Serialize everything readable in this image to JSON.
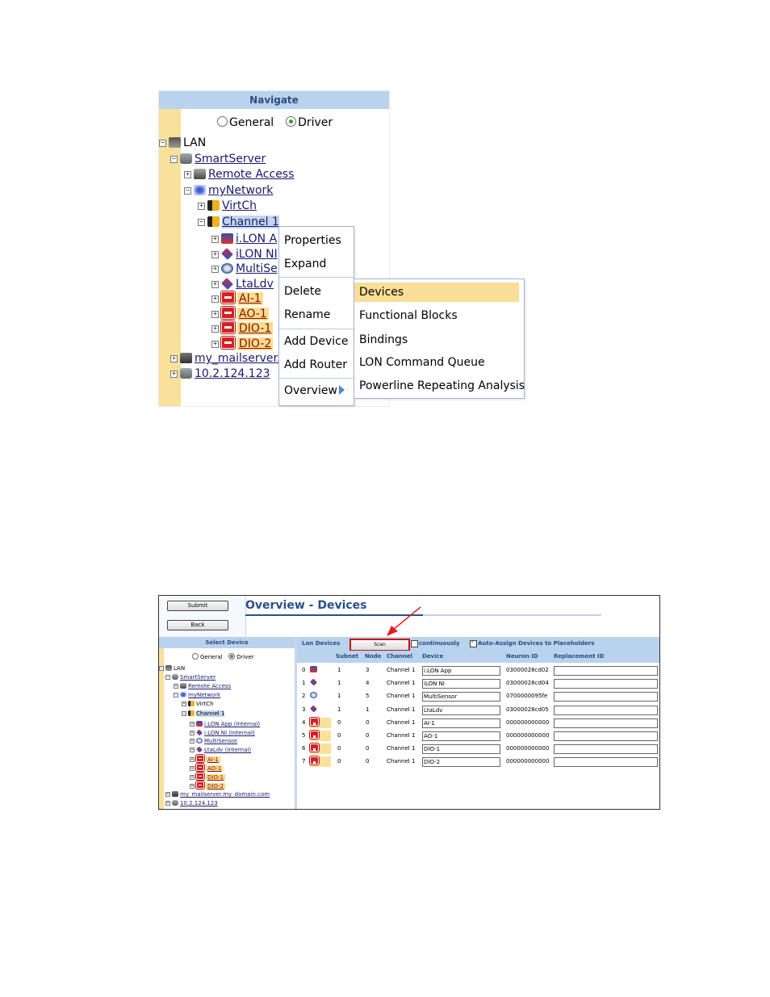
{
  "navigate": {
    "title": "Navigate",
    "view_options": [
      {
        "label": "General",
        "selected": false
      },
      {
        "label": "Driver",
        "selected": true
      }
    ],
    "tree": {
      "lan": "LAN",
      "smartserver": "SmartServer",
      "remote_access": "Remote Access",
      "mynetwork": "myNetwork",
      "virtch": "VirtCh",
      "channel1": "Channel 1",
      "ilon_app": "i.LON A",
      "ilon_ni": "iLON NI",
      "multisensor": "MultiSe",
      "ltaldv": "LtaLdv",
      "ai1": "AI-1",
      "ao1": "AO-1",
      "dio1": "DIO-1",
      "dio2": "DIO-2",
      "mailserver": "my_mailserver.",
      "ip": "10.2.124.123"
    }
  },
  "context_menu": {
    "items": [
      "Properties",
      "Expand",
      "Delete",
      "Rename",
      "Add Device",
      "Add Router",
      "Overview"
    ],
    "submenu": [
      "Devices",
      "Functional Blocks",
      "Bindings",
      "LON Command Queue",
      "Powerline Repeating Analysis"
    ],
    "active_submenu": "Devices"
  },
  "overview": {
    "title": "Overview - Devices",
    "submit_label": "Submit",
    "back_label": "Back",
    "select_device": {
      "title": "Select Device",
      "view_options": [
        {
          "label": "General",
          "selected": false
        },
        {
          "label": "Driver",
          "selected": true
        }
      ],
      "tree": {
        "lan": "LAN",
        "smartserver": "SmartServer",
        "remote_access": "Remote Access",
        "mynetwork": "myNetwork",
        "virtch": "VirtCh",
        "channel1": "Channel 1",
        "ilon_app": "i.LON App (Internal)",
        "ilon_ni": "i.LON NI (Internal)",
        "multisensor": "MultiSensor",
        "ltaldv": "LtaLdv (Internal)",
        "ai1": "AI-1",
        "ao1": "AO-1",
        "dio1": "DIO-1",
        "dio2": "DIO-2",
        "mailserver": "my_mailserver.my_domain.com",
        "ip": "10.2.124.123"
      }
    },
    "lon_devices": {
      "title": "Lon Devices",
      "scan_label": "Scan",
      "continuously_label": "continuously",
      "continuously_checked": false,
      "auto_assign_label": "Auto-Assign Devices to Placeholders",
      "auto_assign_checked": true,
      "columns": [
        "Subnet",
        "Node",
        "Channel",
        "Device",
        "Neuron ID",
        "Replacement ID"
      ],
      "rows": [
        {
          "index": "0",
          "icon": "ilon-app-icon",
          "subnet": "1",
          "node": "3",
          "channel": "Channel 1",
          "device": "i.LON App",
          "neuron_id": "03000028cd02",
          "replacement_id": ""
        },
        {
          "index": "1",
          "icon": "ilon-ni-icon",
          "subnet": "1",
          "node": "4",
          "channel": "Channel 1",
          "device": "iLON NI",
          "neuron_id": "03000028cd04",
          "replacement_id": ""
        },
        {
          "index": "2",
          "icon": "multisensor-icon",
          "subnet": "1",
          "node": "5",
          "channel": "Channel 1",
          "device": "MultiSensor",
          "neuron_id": "0700000095fe",
          "replacement_id": ""
        },
        {
          "index": "3",
          "icon": "ltaldv-icon",
          "subnet": "1",
          "node": "1",
          "channel": "Channel 1",
          "device": "LtaLdv",
          "neuron_id": "03000028cd05",
          "replacement_id": ""
        },
        {
          "index": "4",
          "icon": "placeholder-device-icon",
          "subnet": "0",
          "node": "0",
          "channel": "Channel 1",
          "device": "AI-1",
          "neuron_id": "000000000000",
          "replacement_id": ""
        },
        {
          "index": "5",
          "icon": "placeholder-device-icon",
          "subnet": "0",
          "node": "0",
          "channel": "Channel 1",
          "device": "AO-1",
          "neuron_id": "000000000000",
          "replacement_id": ""
        },
        {
          "index": "6",
          "icon": "placeholder-device-icon",
          "subnet": "0",
          "node": "0",
          "channel": "Channel 1",
          "device": "DIO-1",
          "neuron_id": "000000000000",
          "replacement_id": ""
        },
        {
          "index": "7",
          "icon": "placeholder-device-icon",
          "subnet": "0",
          "node": "0",
          "channel": "Channel 1",
          "device": "DIO-2",
          "neuron_id": "000000000000",
          "replacement_id": ""
        }
      ]
    }
  }
}
